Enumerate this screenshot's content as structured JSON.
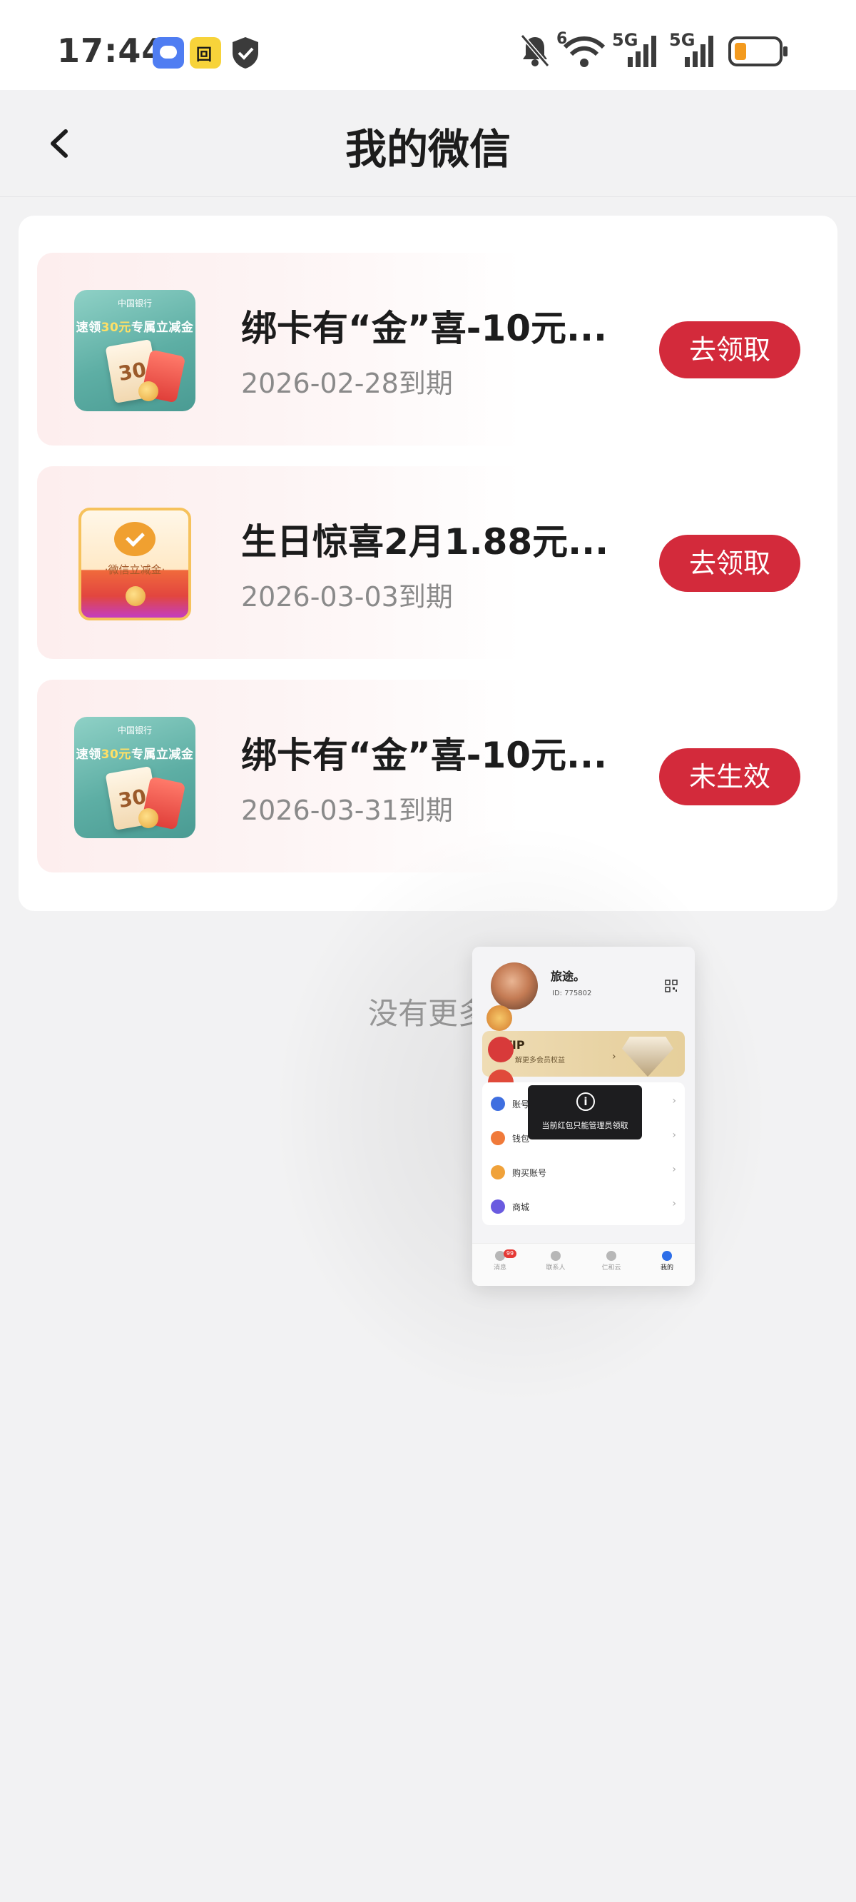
{
  "status_bar": {
    "time": "17:44",
    "apps": [
      "message-icon",
      "game-icon",
      "shield-icon"
    ],
    "network_label_1": "6",
    "network_label_2": "5G",
    "network_label_3": "5G",
    "battery_color": "#f39a1e"
  },
  "header": {
    "title": "我的微信",
    "back_icon": "chevron-left-icon"
  },
  "coupons": [
    {
      "title": "绑卡有“金”喜-10元...",
      "expiry": "2026-02-28到期",
      "button": "去领取",
      "thumb": "bank-promo",
      "thumb_head": "中国银行",
      "thumb_line_pre": "速领",
      "thumb_line_amount": "30元",
      "thumb_line_post": "专属立减金",
      "thumb_number": "30"
    },
    {
      "title": "生日惊喜2月1.88元...",
      "expiry": "2026-03-03到期",
      "button": "去领取",
      "thumb": "wechat-discount",
      "thumb_label": "·微信立减金·"
    },
    {
      "title": "绑卡有“金”喜-10元...",
      "expiry": "2026-03-31到期",
      "button": "未生效",
      "thumb": "bank-promo",
      "thumb_head": "中国银行",
      "thumb_line_pre": "速领",
      "thumb_line_amount": "30元",
      "thumb_line_post": "专属立减金",
      "thumb_number": "30"
    }
  ],
  "footer": {
    "no_more": "没有更多"
  },
  "pip": {
    "name": "旅途。",
    "id": "ID: 775802",
    "vip_title": "SVIP",
    "vip_sub": "解更多会员权益",
    "tip": "当前红包只能管理员领取",
    "menu": [
      {
        "label": "账号",
        "color": "#3f6fe0"
      },
      {
        "label": "钱包",
        "color": "#f07a3a"
      },
      {
        "label": "购买账号",
        "color": "#f0a23a"
      },
      {
        "label": "商城",
        "color": "#6a5be0"
      }
    ],
    "tabs": [
      {
        "label": "消息",
        "badge": "99"
      },
      {
        "label": "联系人"
      },
      {
        "label": "仁和云"
      },
      {
        "label": "我的"
      }
    ],
    "accent": "#d32a3b"
  }
}
